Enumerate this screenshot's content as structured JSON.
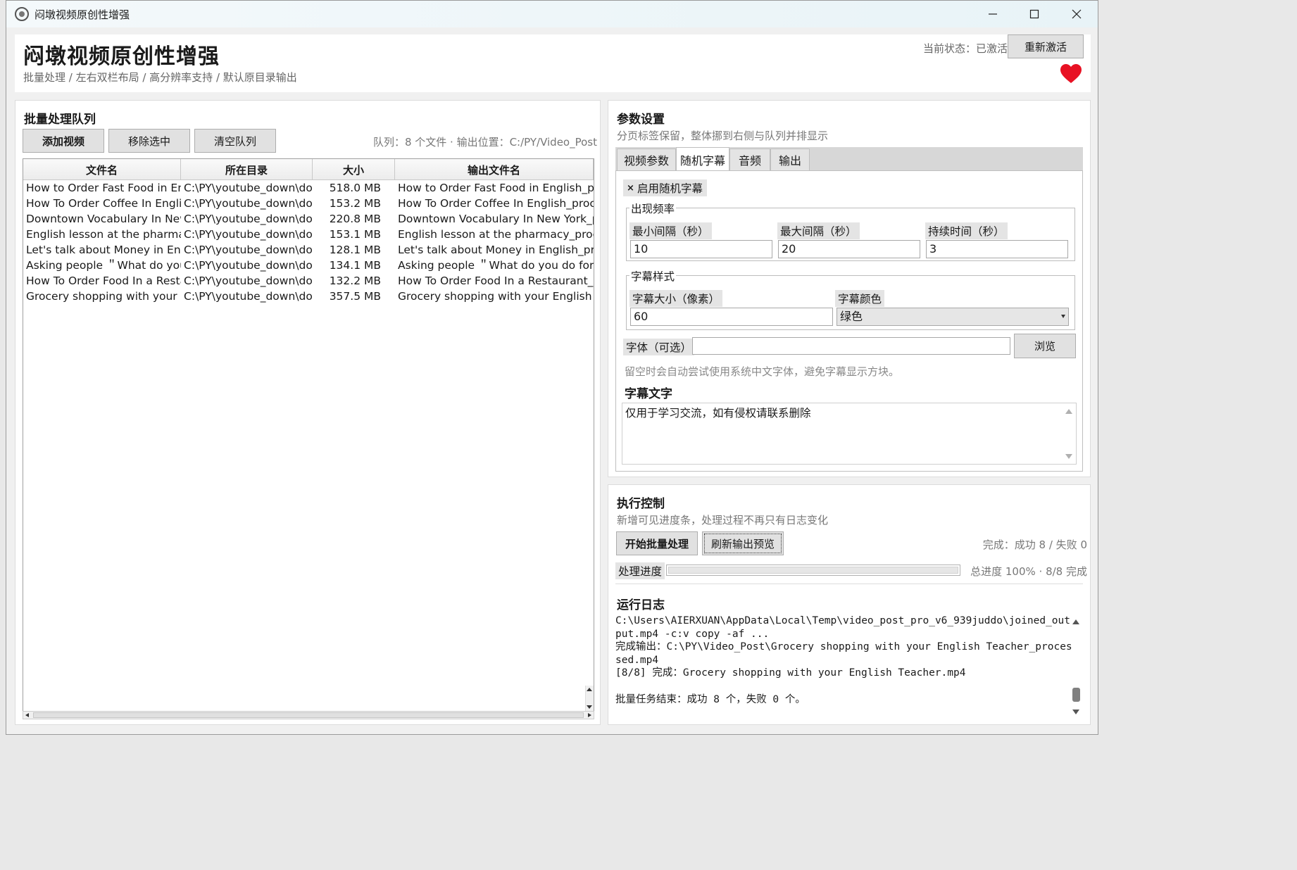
{
  "window": {
    "title": "闷墩视频原创性增强"
  },
  "header": {
    "title": "闷墩视频原创性增强",
    "subtitle": "批量处理 / 左右双栏布局 / 高分辨率支持 / 默认原目录输出",
    "status_text": "当前状态：已激活",
    "reactivate_label": "重新激活",
    "heart_color": "#e81123"
  },
  "queue": {
    "title": "批量处理队列",
    "add_label": "添加视频",
    "remove_label": "移除选中",
    "clear_label": "清空队列",
    "info": "队列：8 个文件 · 输出位置：C:/PY/Video_Post",
    "columns": [
      "文件名",
      "所在目录",
      "大小",
      "输出文件名"
    ],
    "rows": [
      {
        "name": "How to Order Fast Food in En",
        "dir": "C:\\PY\\youtube_down\\do",
        "size": "518.0 MB",
        "out": "How to Order Fast Food in English_pr"
      },
      {
        "name": "How To Order Coffee In Englis",
        "dir": "C:\\PY\\youtube_down\\do",
        "size": "153.2 MB",
        "out": "How To Order Coffee In English_proce"
      },
      {
        "name": "Downtown Vocabulary In New",
        "dir": "C:\\PY\\youtube_down\\do",
        "size": "220.8 MB",
        "out": "Downtown Vocabulary In New York_p"
      },
      {
        "name": "English lesson at the pharmac",
        "dir": "C:\\PY\\youtube_down\\do",
        "size": "153.1 MB",
        "out": "English lesson at the pharmacy_proce"
      },
      {
        "name": "Let's talk about Money in Eng",
        "dir": "C:\\PY\\youtube_down\\do",
        "size": "128.1 MB",
        "out": "Let's talk about Money in English_pro"
      },
      {
        "name": "Asking people ＂What do you",
        "dir": "C:\\PY\\youtube_down\\do",
        "size": "134.1 MB",
        "out": "Asking people ＂What do you do for ."
      },
      {
        "name": "How To Order Food In a Resta",
        "dir": "C:\\PY\\youtube_down\\do",
        "size": "132.2 MB",
        "out": "How To Order Food In a Restaurant_p"
      },
      {
        "name": "Grocery shopping with your E",
        "dir": "C:\\PY\\youtube_down\\do",
        "size": "357.5 MB",
        "out": "Grocery shopping with your English T"
      }
    ]
  },
  "params": {
    "title": "参数设置",
    "subtitle": "分页标签保留，整体挪到右侧与队列并排显示",
    "tabs": [
      "视频参数",
      "随机字幕",
      "音频",
      "输出"
    ],
    "active_tab": "随机字幕",
    "enable_label": "启用随机字幕",
    "freq_group": "出现频率",
    "min_label": "最小间隔（秒）",
    "min_value": "10",
    "max_label": "最大间隔（秒）",
    "max_value": "20",
    "dur_label": "持续时间（秒）",
    "dur_value": "3",
    "style_group": "字幕样式",
    "size_label": "字幕大小（像素）",
    "size_value": "60",
    "color_label": "字幕颜色",
    "color_value": "绿色",
    "font_label": "字体（可选）",
    "font_value": "",
    "browse_label": "浏览",
    "font_hint": "留空时会自动尝试使用系统中文字体，避免字幕显示方块。",
    "text_title": "字幕文字",
    "text_value": "仅用于学习交流，如有侵权请联系删除"
  },
  "exec": {
    "title": "执行控制",
    "subtitle": "新增可见进度条，处理过程不再只有日志变化",
    "start_label": "开始批量处理",
    "refresh_label": "刷新输出预览",
    "result": "完成：成功 8 / 失败 0",
    "progress_label": "处理进度",
    "progress_value": 1.0,
    "progress_text": "总进度 100% · 8/8 完成",
    "log_title": "运行日志",
    "log_lines": [
      "C:\\Users\\AIERXUAN\\AppData\\Local\\Temp\\video_post_pro_v6_939juddo\\joined_output.mp4 -c:v copy -af ...",
      "完成输出：C:\\PY\\Video_Post\\Grocery shopping with your English Teacher_processed.mp4",
      "[8/8] 完成：Grocery shopping with your English Teacher.mp4",
      "",
      "批量任务结束：成功 8 个，失败 0 个。"
    ]
  }
}
